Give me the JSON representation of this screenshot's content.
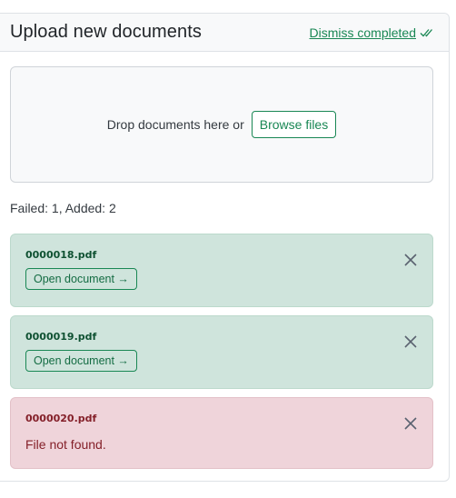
{
  "header": {
    "title": "Upload new documents",
    "dismiss_label": "Dismiss completed"
  },
  "dropzone": {
    "text": "Drop documents here or",
    "browse_label": "Browse files"
  },
  "summary": "Failed: 1, Added: 2",
  "items": [
    {
      "filename": "0000018.pdf",
      "status": "success",
      "action_label": "Open document →"
    },
    {
      "filename": "0000019.pdf",
      "status": "success",
      "action_label": "Open document →"
    },
    {
      "filename": "0000020.pdf",
      "status": "failed",
      "message": "File not found."
    }
  ],
  "colors": {
    "accent": "#198754",
    "success_bg": "#cfe4dc",
    "error_bg": "#efd4da",
    "error_text": "#842029"
  },
  "icons": {
    "dismiss": "check-all-icon",
    "remove": "close-icon"
  }
}
